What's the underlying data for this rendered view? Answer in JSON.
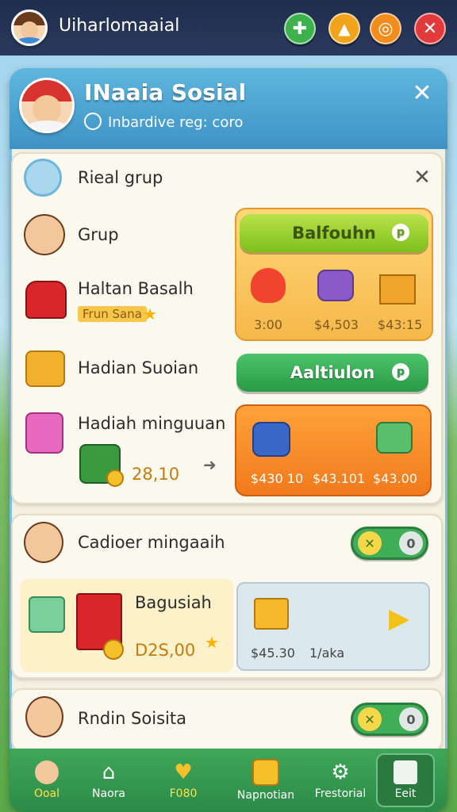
{
  "topbar": {
    "title": "Uiharlomaaial"
  },
  "panel": {
    "title": "INaaia Sosial",
    "subtitle": "Inbardive reg: coro"
  },
  "section1": {
    "header": "Rieal grup",
    "rows": [
      {
        "label": "Grup"
      },
      {
        "label": "Haltan Basalh",
        "badge": "Frun Sana"
      },
      {
        "label": "Hadian Suoian"
      },
      {
        "label": "Hadiah minguuan",
        "amount": "28,10"
      }
    ],
    "button1": {
      "label": "Balfouhn",
      "icon": "coin-icon"
    },
    "reward1": {
      "prices": [
        "3:00",
        "$4,503",
        "$43:15"
      ]
    },
    "button2": {
      "label": "Aaltiulon",
      "icon": "coin-icon"
    },
    "reward2": {
      "prices": [
        "$430 10",
        "$43.101",
        "$43.00"
      ]
    }
  },
  "section2": {
    "header": "Cadioer mingaaih",
    "item_title": "Bagusiah",
    "item_price": "D2S,00",
    "offer_prices": [
      "$45.30",
      "1/aka"
    ]
  },
  "section3": {
    "header": "Rndin Soisita"
  },
  "nav": [
    {
      "label": "Ooal",
      "icon": "avatar-icon"
    },
    {
      "label": "Naora",
      "icon": "home-icon"
    },
    {
      "label": "F080",
      "icon": "heart-icon"
    },
    {
      "label": "Napnotian",
      "icon": "gift-icon"
    },
    {
      "label": "Frestorial",
      "icon": "settings-icon"
    },
    {
      "label": "Eeit",
      "icon": "exit-icon"
    }
  ],
  "colors": {
    "accent": "#3e93c4",
    "green": "#3fae57",
    "orange": "#f39a28",
    "red": "#e23a3a"
  }
}
